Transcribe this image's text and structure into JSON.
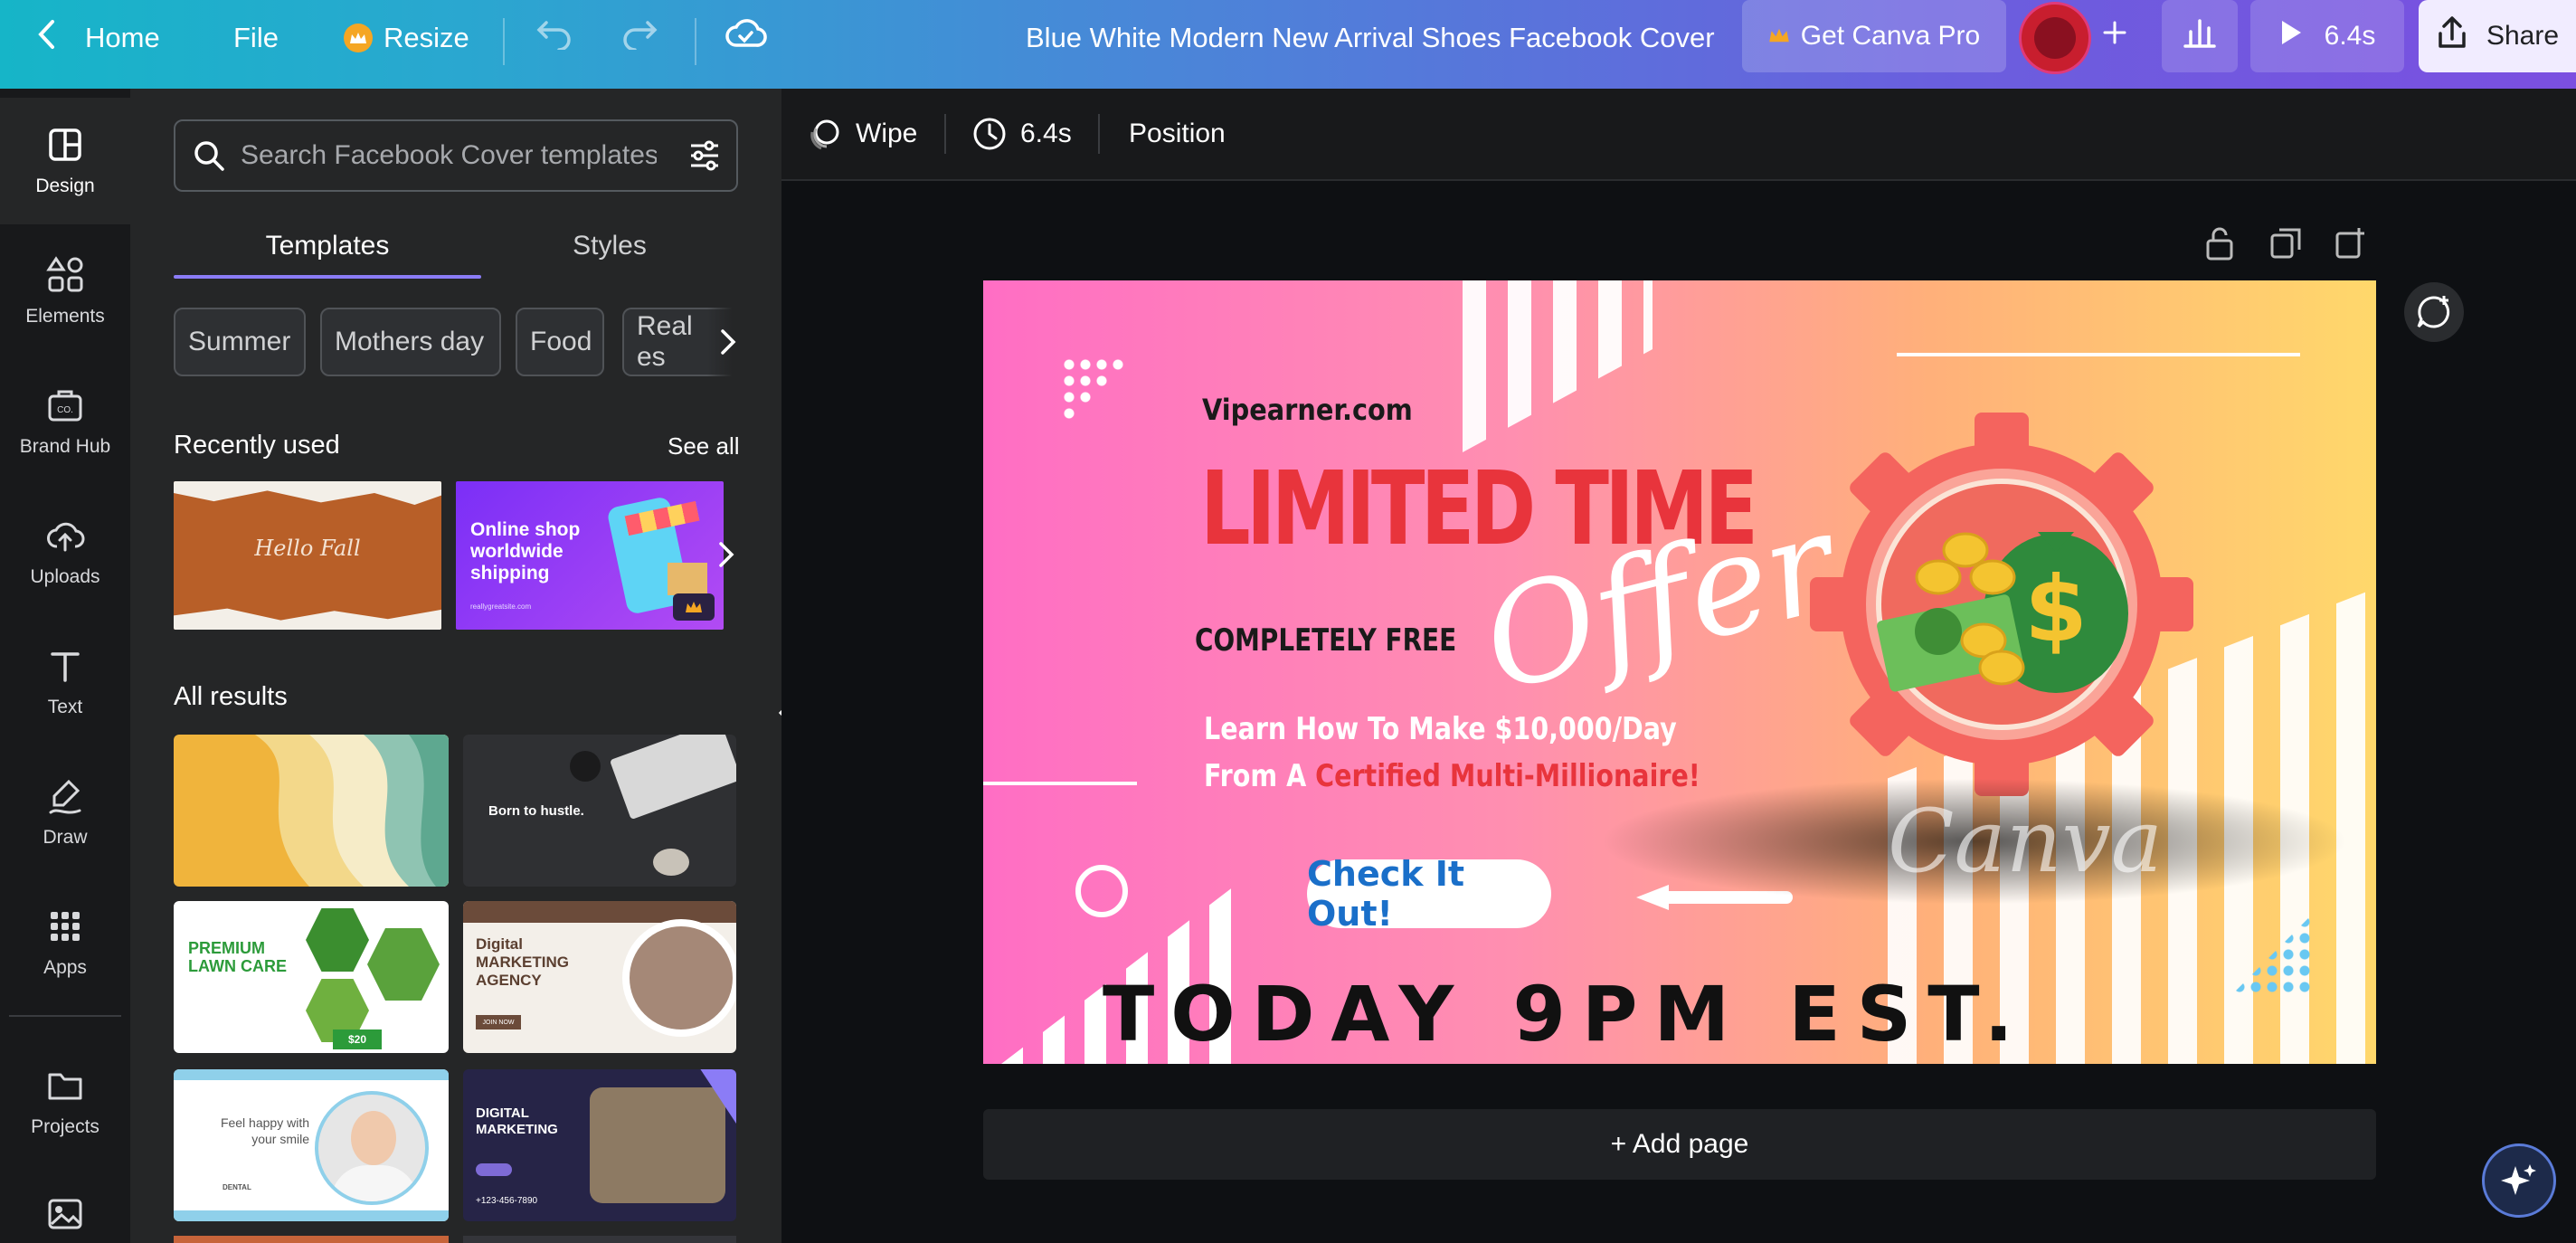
{
  "topbar": {
    "home": "Home",
    "file": "File",
    "resize": "Resize",
    "title": "Blue White Modern New Arrival Shoes Facebook Cover",
    "get_pro": "Get Canva Pro",
    "duration": "6.4s",
    "share": "Share"
  },
  "leftnav": {
    "items": [
      {
        "label": "Design"
      },
      {
        "label": "Elements"
      },
      {
        "label": "Brand Hub"
      },
      {
        "label": "Uploads"
      },
      {
        "label": "Text"
      },
      {
        "label": "Draw"
      },
      {
        "label": "Apps"
      },
      {
        "label": "Projects"
      }
    ]
  },
  "panel": {
    "search_placeholder": "Search Facebook Cover templates",
    "tabs": [
      {
        "label": "Templates"
      },
      {
        "label": "Styles"
      }
    ],
    "chips": [
      "Summer",
      "Mothers day",
      "Food",
      "Real es"
    ],
    "recently_used": "Recently used",
    "see_all": "See all",
    "all_results": "All results",
    "recent_thumbs": [
      {
        "text": "Hello Fall"
      },
      {
        "text": "Online shop worldwide shipping",
        "small": "reallygreatsite.com"
      }
    ],
    "result_thumbs": [
      {
        "text": ""
      },
      {
        "text": "Born to hustle."
      },
      {
        "text": "PREMIUM LAWN CARE",
        "sub": "$20"
      },
      {
        "text": "Digital MARKETING AGENCY",
        "sub": "JOIN NOW"
      },
      {
        "text": "Feel happy with your smile",
        "sub": "DENTAL"
      },
      {
        "text": "DIGITAL MARKETING",
        "sub": "+123-456-7890"
      }
    ]
  },
  "editor_toolbar": {
    "wipe": "Wipe",
    "duration": "6.4s",
    "position": "Position"
  },
  "canvas": {
    "site": "Vipearner.com",
    "headline": "LIMITED TIME",
    "offer": "Offer",
    "free": "COMPLETELY FREE",
    "line1": "Learn How To Make $10,000/Day",
    "line2_prefix": "From A ",
    "line2_highlight": "Certified Multi-Millionaire!",
    "cta": "Check It Out!",
    "footer": "TODAY 9PM EST.",
    "watermark": "Canva"
  },
  "add_page": "+ Add page",
  "colors": {
    "headline_red": "#e8343c",
    "cta_blue": "#1a6fc9",
    "accent_purple": "#8b3dff"
  }
}
